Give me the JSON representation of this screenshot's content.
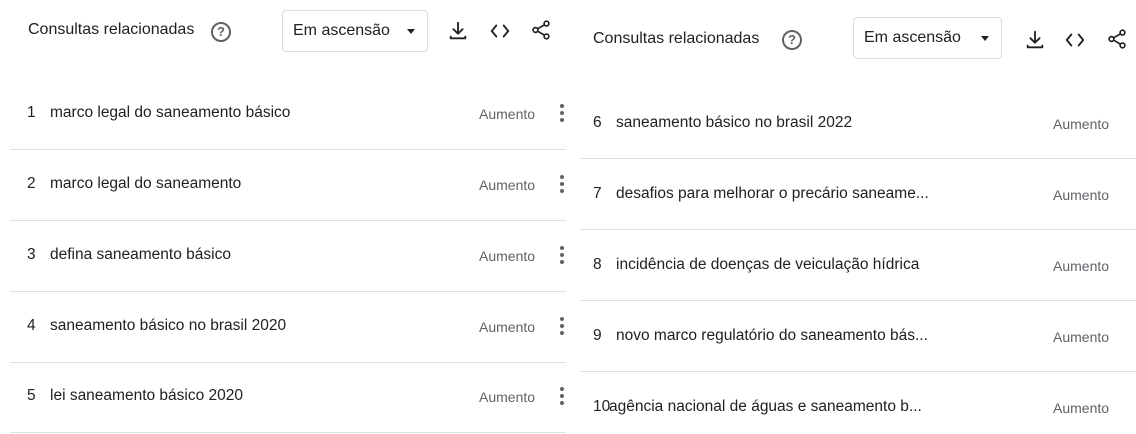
{
  "left": {
    "title": "Consultas relacionadas",
    "help_glyph": "?",
    "filter": "Em ascensão",
    "rows": [
      {
        "rank": "1",
        "query": "marco legal do saneamento básico",
        "value": "Aumento"
      },
      {
        "rank": "2",
        "query": "marco legal do saneamento",
        "value": "Aumento"
      },
      {
        "rank": "3",
        "query": "defina saneamento básico",
        "value": "Aumento"
      },
      {
        "rank": "4",
        "query": "saneamento básico no brasil 2020",
        "value": "Aumento"
      },
      {
        "rank": "5",
        "query": "lei saneamento básico 2020",
        "value": "Aumento"
      }
    ]
  },
  "right": {
    "title": "Consultas relacionadas",
    "help_glyph": "?",
    "filter": "Em ascensão",
    "rows": [
      {
        "rank": "6",
        "query": "saneamento básico no brasil 2022",
        "value": "Aumento"
      },
      {
        "rank": "7",
        "query": "desafios para melhorar o precário saneame...",
        "value": "Aumento"
      },
      {
        "rank": "8",
        "query": "incidência de doenças de veiculação hídrica",
        "value": "Aumento"
      },
      {
        "rank": "9",
        "query": "novo marco regulatório do saneamento bás...",
        "value": "Aumento"
      },
      {
        "rank": "10",
        "query": "agência nacional de águas e saneamento b...",
        "value": "Aumento"
      }
    ]
  },
  "icons": {
    "help": "help-circle-icon",
    "download": "download-icon",
    "embed": "embed-code-icon",
    "share": "share-icon",
    "more": "more-vert-icon"
  },
  "colors": {
    "text": "#202124",
    "muted": "#5f6368",
    "divider": "#e0e0e0"
  }
}
